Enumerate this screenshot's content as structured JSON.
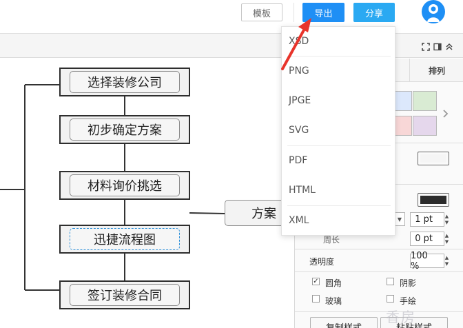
{
  "header": {
    "template_label": "模板",
    "export_label": "导出",
    "share_label": "分享"
  },
  "export_menu": {
    "items": [
      "XSD",
      "PNG",
      "JPGE",
      "SVG",
      "PDF",
      "HTML",
      "XML"
    ]
  },
  "flowchart": {
    "nodes": [
      "选择装修公司",
      "初步确定方案",
      "材料询价挑选",
      "迅捷流程图",
      "签订装修合同"
    ],
    "side_node": "方案"
  },
  "panel": {
    "tab_arrange": "排列",
    "swatch_colors": [
      "#dce8fc",
      "#d9ebd3",
      "#f8d7d7",
      "#e5d7ec"
    ],
    "fill_color": "#f5f5f5",
    "line_color": "#2b2b2b",
    "line_width_value": "1 pt",
    "perimeter_label": "周长",
    "perimeter_value": "0 pt",
    "opacity_label": "透明度",
    "opacity_value": "100 %",
    "rounded_label": "圆角",
    "rounded_checked": "✓",
    "shadow_label": "阴影",
    "glass_label": "玻璃",
    "sketch_label": "手绘",
    "copy_style_label": "复制样式",
    "paste_style_label": "粘贴样式"
  },
  "watermark": "香房"
}
